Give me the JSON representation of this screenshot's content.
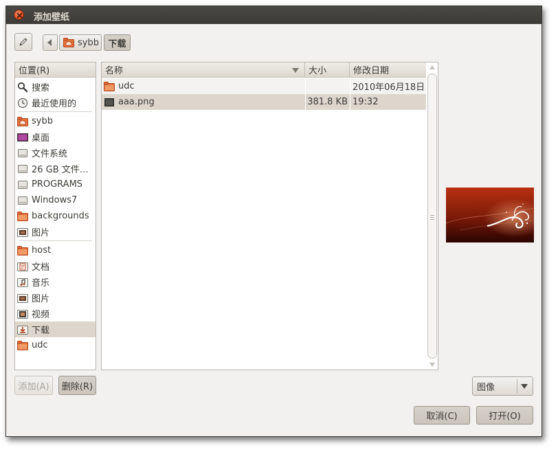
{
  "window": {
    "title": "添加壁纸",
    "close_icon": "close-icon"
  },
  "toolbar": {
    "edit_icon": "pencil-icon",
    "back_icon": "left-arrow-icon",
    "breadcrumbs": [
      {
        "label": "sybb",
        "icon": "home-folder-icon"
      },
      {
        "label": "下载"
      }
    ]
  },
  "places": {
    "header": "位置(R)",
    "items": [
      {
        "label": "搜索",
        "icon": "search-icon"
      },
      {
        "label": "最近使用的",
        "icon": "recent-clock-icon"
      },
      {
        "label": "sybb",
        "icon": "home-folder-icon"
      },
      {
        "label": "桌面",
        "icon": "desktop-icon"
      },
      {
        "label": "文件系统",
        "icon": "drive-icon"
      },
      {
        "label": "26 GB 文件…",
        "icon": "drive-icon"
      },
      {
        "label": "PROGRAMS",
        "icon": "drive-icon"
      },
      {
        "label": "Windows7",
        "icon": "drive-icon"
      },
      {
        "label": "backgrounds",
        "icon": "folder-icon"
      },
      {
        "label": "图片",
        "icon": "pictures-folder-icon"
      },
      {
        "label": "host",
        "icon": "folder-icon"
      },
      {
        "label": "文档",
        "icon": "documents-folder-icon"
      },
      {
        "label": "音乐",
        "icon": "music-folder-icon"
      },
      {
        "label": "图片",
        "icon": "pictures-folder-icon"
      },
      {
        "label": "视频",
        "icon": "videos-folder-icon"
      },
      {
        "label": "下载",
        "icon": "downloads-folder-icon",
        "selected": true
      },
      {
        "label": "udc",
        "icon": "folder-icon"
      }
    ]
  },
  "files": {
    "columns": {
      "name": "名称",
      "size": "大小",
      "modified": "修改日期"
    },
    "rows": [
      {
        "name": "udc",
        "size": "",
        "modified": "2010年06月18日",
        "icon": "folder-icon"
      },
      {
        "name": "aaa.png",
        "size": "381.8 KB",
        "modified": "19:32",
        "icon": "image-file-icon",
        "selected": true
      }
    ]
  },
  "buttons": {
    "add": "添加(A)",
    "remove": "删除(R)",
    "cancel": "取消(C)",
    "open": "打开(O)"
  },
  "filter": {
    "selected": "图像"
  },
  "colors": {
    "title_bar": "#3c3b37",
    "close_button": "#df4a16",
    "selection": "#dcd6cd",
    "window_bg": "#f2f1f0"
  }
}
